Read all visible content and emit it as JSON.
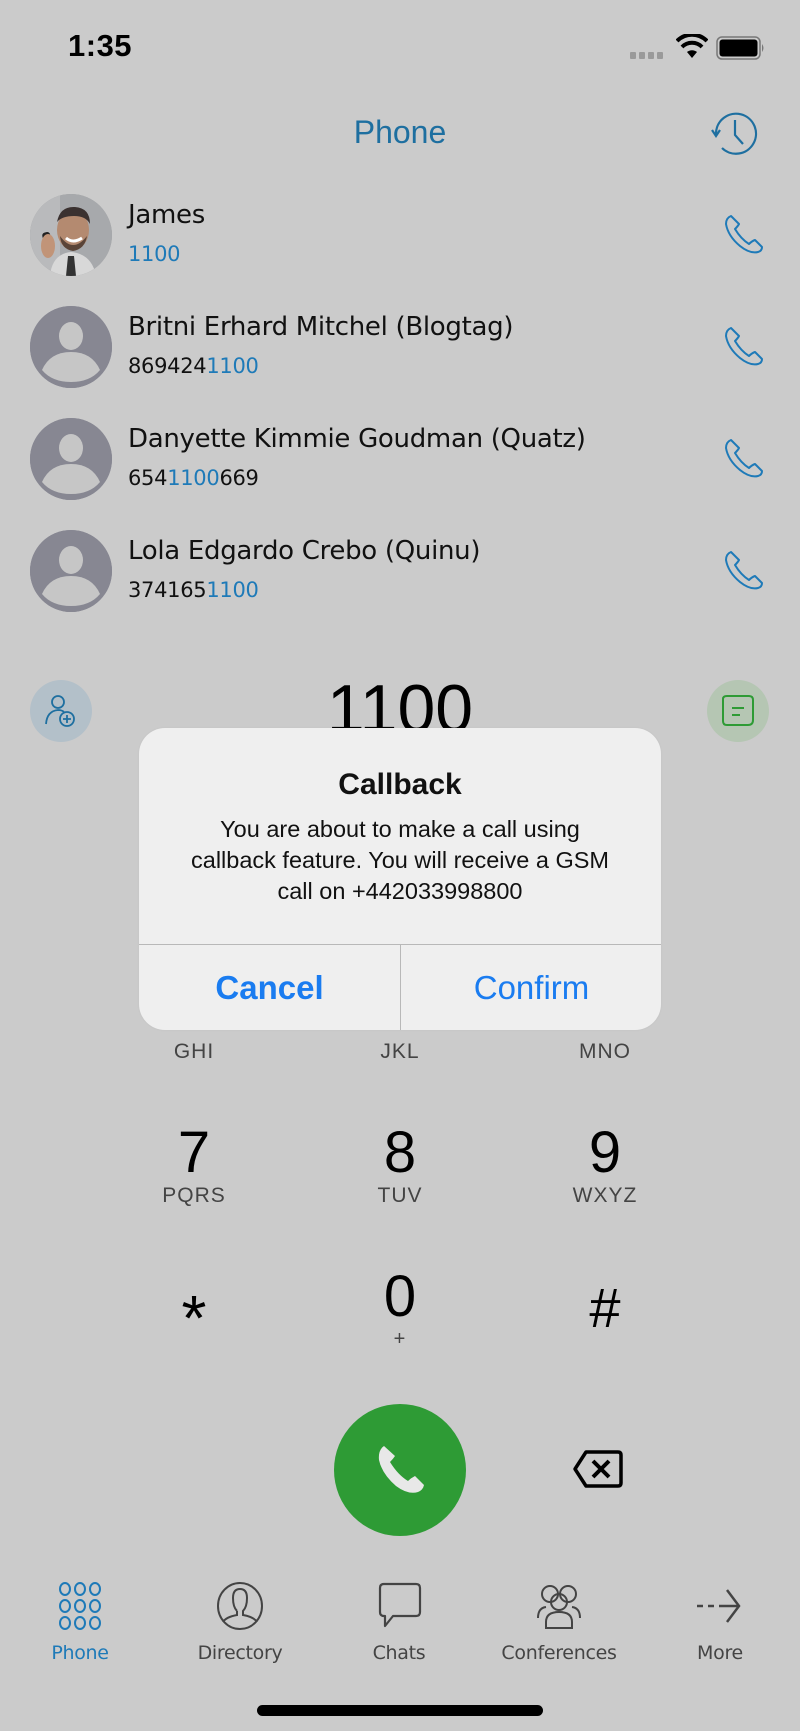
{
  "status_bar": {
    "time": "1:35",
    "icons": [
      "cellular-signal-icon",
      "wifi-icon",
      "battery-icon"
    ]
  },
  "header": {
    "title": "Phone",
    "history_icon": "history-icon"
  },
  "contacts": [
    {
      "name": "James",
      "number_prefix": "",
      "number_match": "1100",
      "number_suffix": "",
      "avatar": "photo"
    },
    {
      "name": "Britni Erhard Mitchel (Blogtag)",
      "number_prefix": "869424",
      "number_match": "1100",
      "number_suffix": "",
      "avatar": "placeholder"
    },
    {
      "name": "Danyette Kimmie Goudman (Quatz)",
      "number_prefix": "654",
      "number_match": "1100",
      "number_suffix": "669",
      "avatar": "placeholder"
    },
    {
      "name": "Lola Edgardo Crebo (Quinu)",
      "number_prefix": "374165",
      "number_match": "1100",
      "number_suffix": "",
      "avatar": "placeholder"
    }
  ],
  "dialer": {
    "number": "1100",
    "add_contact_icon": "add-contact-icon",
    "message_icon": "message-icon"
  },
  "keypad": {
    "partial_row_letters": [
      "GHI",
      "JKL",
      "MNO"
    ],
    "rows": [
      [
        {
          "digit": "7",
          "letters": "PQRS"
        },
        {
          "digit": "8",
          "letters": "TUV"
        },
        {
          "digit": "9",
          "letters": "WXYZ"
        }
      ],
      [
        {
          "digit": "*",
          "letters": ""
        },
        {
          "digit": "0",
          "letters": "+"
        },
        {
          "digit": "#",
          "letters": ""
        }
      ]
    ]
  },
  "dialog": {
    "title": "Callback",
    "message": "You are about to make a call using callback feature. You will receive a GSM call on +442033998800",
    "cancel_label": "Cancel",
    "confirm_label": "Confirm"
  },
  "tab_bar": {
    "tabs": [
      {
        "label": "Phone",
        "icon": "keypad-icon",
        "active": true
      },
      {
        "label": "Directory",
        "icon": "directory-icon",
        "active": false
      },
      {
        "label": "Chats",
        "icon": "chat-icon",
        "active": false
      },
      {
        "label": "Conferences",
        "icon": "conferences-icon",
        "active": false
      },
      {
        "label": "More",
        "icon": "more-arrow-icon",
        "active": false
      }
    ]
  },
  "colors": {
    "accent_blue": "#1e7ab8",
    "call_green": "#2e9b35",
    "dialog_button_blue": "#1a7cf0",
    "background": "#cbcbcb"
  }
}
